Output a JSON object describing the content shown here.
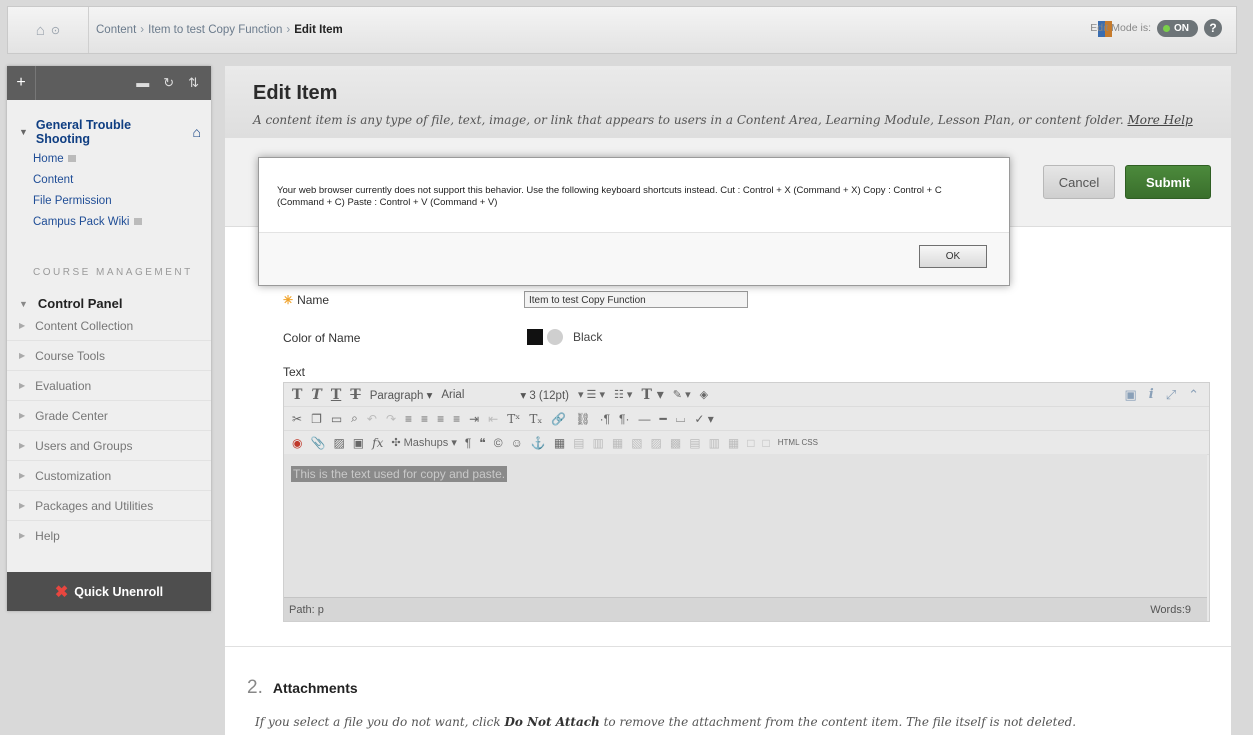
{
  "breadcrumb": {
    "items": [
      "Content",
      "Item to test Copy Function"
    ],
    "current": "Edit Item"
  },
  "edit_mode": {
    "label": "Edit Mode is:",
    "state": "ON",
    "help": "?"
  },
  "sidebar": {
    "course_title": "General Trouble Shooting",
    "links": [
      "Home",
      "Content",
      "File Permission",
      "Campus Pack Wiki"
    ],
    "management_label": "COURSE MANAGEMENT",
    "control_panel": "Control Panel",
    "cp_items": [
      "Content Collection",
      "Course Tools",
      "Evaluation",
      "Grade Center",
      "Users and Groups",
      "Customization",
      "Packages and Utilities",
      "Help"
    ],
    "quick_unenroll": "Quick Unenroll"
  },
  "page": {
    "title": "Edit Item",
    "description": "A content item is any type of file, text, image, or link that appears to users in a Content Area, Learning Module, Lesson Plan, or content folder.",
    "more_help": "More Help",
    "cancel": "Cancel",
    "submit": "Submit"
  },
  "form": {
    "name_label": "Name",
    "name_value": "Item to test Copy Function",
    "color_label": "Color of Name",
    "color_value": "Black",
    "text_label": "Text",
    "toolbar": {
      "paragraph": "Paragraph",
      "font": "Arial",
      "size": "3 (12pt)",
      "mashups": "Mashups",
      "html_css": "HTML CSS"
    },
    "editor_text": "This is the text used for copy and paste.",
    "path": "Path: p",
    "words": "Words:9"
  },
  "attachments": {
    "number": "2.",
    "title": "Attachments",
    "note_pre": "If you select a file you do not want, click ",
    "note_bold": "Do Not Attach",
    "note_post": " to remove the attachment from the content item. The file itself is not deleted."
  },
  "dialog": {
    "message": "Your web browser currently does not support this behavior. Use the following keyboard shortcuts instead. Cut : Control + X (Command + X) Copy : Control + C (Command + C) Paste : Control + V (Command + V)",
    "ok": "OK"
  }
}
